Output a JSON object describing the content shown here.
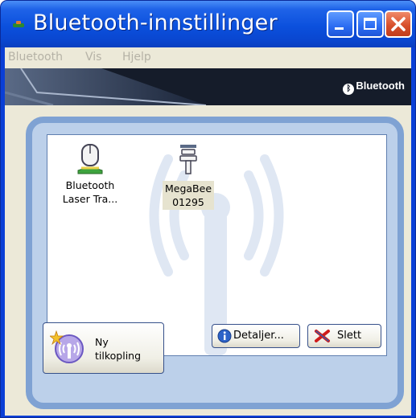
{
  "window": {
    "title": "Bluetooth-innstillinger"
  },
  "menubar": {
    "items": [
      "Bluetooth",
      "Vis",
      "Hjelp"
    ]
  },
  "banner": {
    "brand": "Bluetooth"
  },
  "devices": [
    {
      "name": "Bluetooth\nLaser Tra...",
      "icon": "mouse-device-icon",
      "selected": false
    },
    {
      "name": "MegaBee\n01295",
      "icon": "bluetooth-adapter-icon",
      "selected": true
    }
  ],
  "buttons": {
    "new_connection": "Ny\ntilkopling",
    "details": "Detaljer...",
    "delete": "Slett"
  },
  "colors": {
    "titlebar": "#0b50dd",
    "client": "#ece9d8",
    "panel": "#7fa2d3",
    "banner": "#151c2a"
  }
}
